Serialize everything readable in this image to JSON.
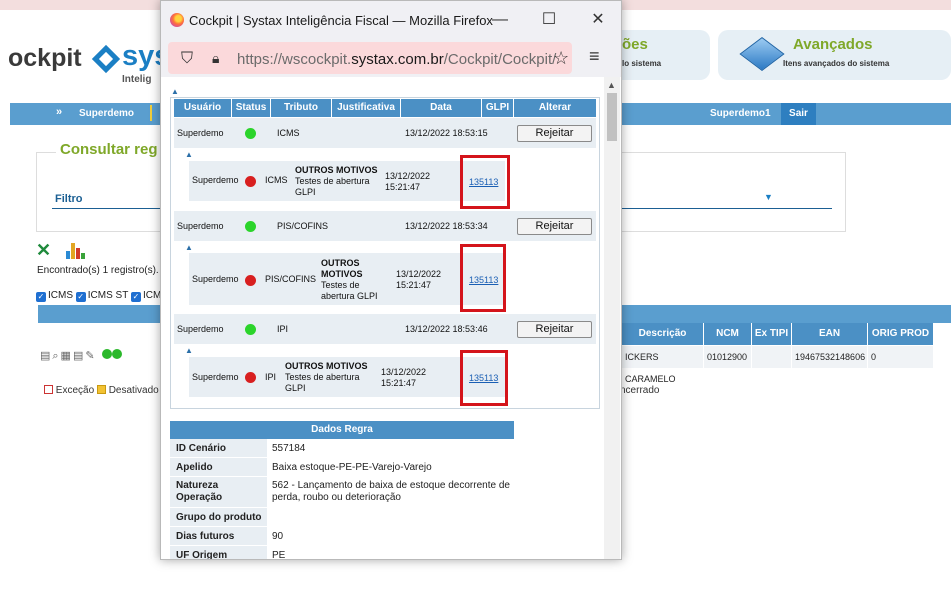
{
  "window": {
    "title": "Cockpit | Systax Inteligência Fiscal — Mozilla Firefox",
    "url_prefix": "https://wscockpit.",
    "url_domain": "systax.com.br",
    "url_path": "/Cockpit/Cockpit/",
    "minimize": "—",
    "maximize": "☐",
    "close": "✕"
  },
  "background": {
    "logo_word": "ockpit",
    "logo_brand": "sys",
    "logo_sub": "Intelig",
    "header_box1_title": "ões",
    "header_box1_sub": "lo sistema",
    "header_box2_title": "Avançados",
    "header_box2_sub": "Itens avançados do sistema",
    "nav_user": "Superdemo",
    "nav_user2": "Superdemo1",
    "nav_logout": "Sair",
    "consult_title": "Consultar reg",
    "filter_label": "Filtro",
    "found_text": "Encontrado(s) 1 registro(s).",
    "checkboxes": [
      "ICMS",
      "ICMS ST",
      "ICM"
    ],
    "columns": [
      "Descrição",
      "NCM",
      "Ex TIPI",
      "EAN",
      "ORIG PROD"
    ],
    "row": [
      "ICKERS CARAMELO",
      "01012900",
      "",
      "19467532148606",
      "0"
    ],
    "legend": [
      "Exceção",
      "Desativado"
    ],
    "encerrado": "ncerrado"
  },
  "table": {
    "headers": [
      "Usuário",
      "Status",
      "Tributo",
      "Justificativa",
      "Data",
      "GLPI",
      "Alterar"
    ],
    "rows": [
      {
        "usuario": "Superdemo",
        "status": "green",
        "tributo": "ICMS",
        "justificativa": "",
        "data": "13/12/2022 18:53:15",
        "glpi": "",
        "alterar": "Rejeitar",
        "sub": {
          "usuario": "Superdemo",
          "status": "red",
          "tributo": "ICMS",
          "motivo_title": "OUTROS MOTIVOS",
          "motivo_text": "Testes de abertura GLPI",
          "data": "13/12/2022 15:21:47",
          "glpi": "135113"
        }
      },
      {
        "usuario": "Superdemo",
        "status": "green",
        "tributo": "PIS/COFINS",
        "justificativa": "",
        "data": "13/12/2022 18:53:34",
        "glpi": "",
        "alterar": "Rejeitar",
        "sub": {
          "usuario": "Superdemo",
          "status": "red",
          "tributo": "PIS/COFINS",
          "motivo_title": "OUTROS MOTIVOS",
          "motivo_text": "Testes de abertura GLPI",
          "data": "13/12/2022 15:21:47",
          "glpi": "135113"
        }
      },
      {
        "usuario": "Superdemo",
        "status": "green",
        "tributo": "IPI",
        "justificativa": "",
        "data": "13/12/2022 18:53:46",
        "glpi": "",
        "alterar": "Rejeitar",
        "sub": {
          "usuario": "Superdemo",
          "status": "red",
          "tributo": "IPI",
          "motivo_title": "OUTROS MOTIVOS",
          "motivo_text": "Testes de abertura GLPI",
          "data": "13/12/2022 15:21:47",
          "glpi": "135113"
        }
      }
    ]
  },
  "dados_regra": {
    "title": "Dados Regra",
    "fields": [
      {
        "label": "ID Cenário",
        "value": "557184"
      },
      {
        "label": "Apelido",
        "value": "Baixa estoque-PE-PE-Varejo-Varejo"
      },
      {
        "label": "Natureza Operação",
        "value": "562 - Lançamento de baixa de estoque decorrente de perda, roubo ou deterioração"
      },
      {
        "label": "Grupo do produto",
        "value": ""
      },
      {
        "label": "Dias futuros",
        "value": "90"
      },
      {
        "label": "UF Origem",
        "value": "PE"
      }
    ]
  },
  "colors": {
    "header_blue": "#4b90c5",
    "row_bg": "#e8eef3",
    "status_green": "#2bd42b",
    "status_red": "#d81f1f",
    "highlight_red": "#d4141b",
    "url_bg": "#fbd9db"
  }
}
